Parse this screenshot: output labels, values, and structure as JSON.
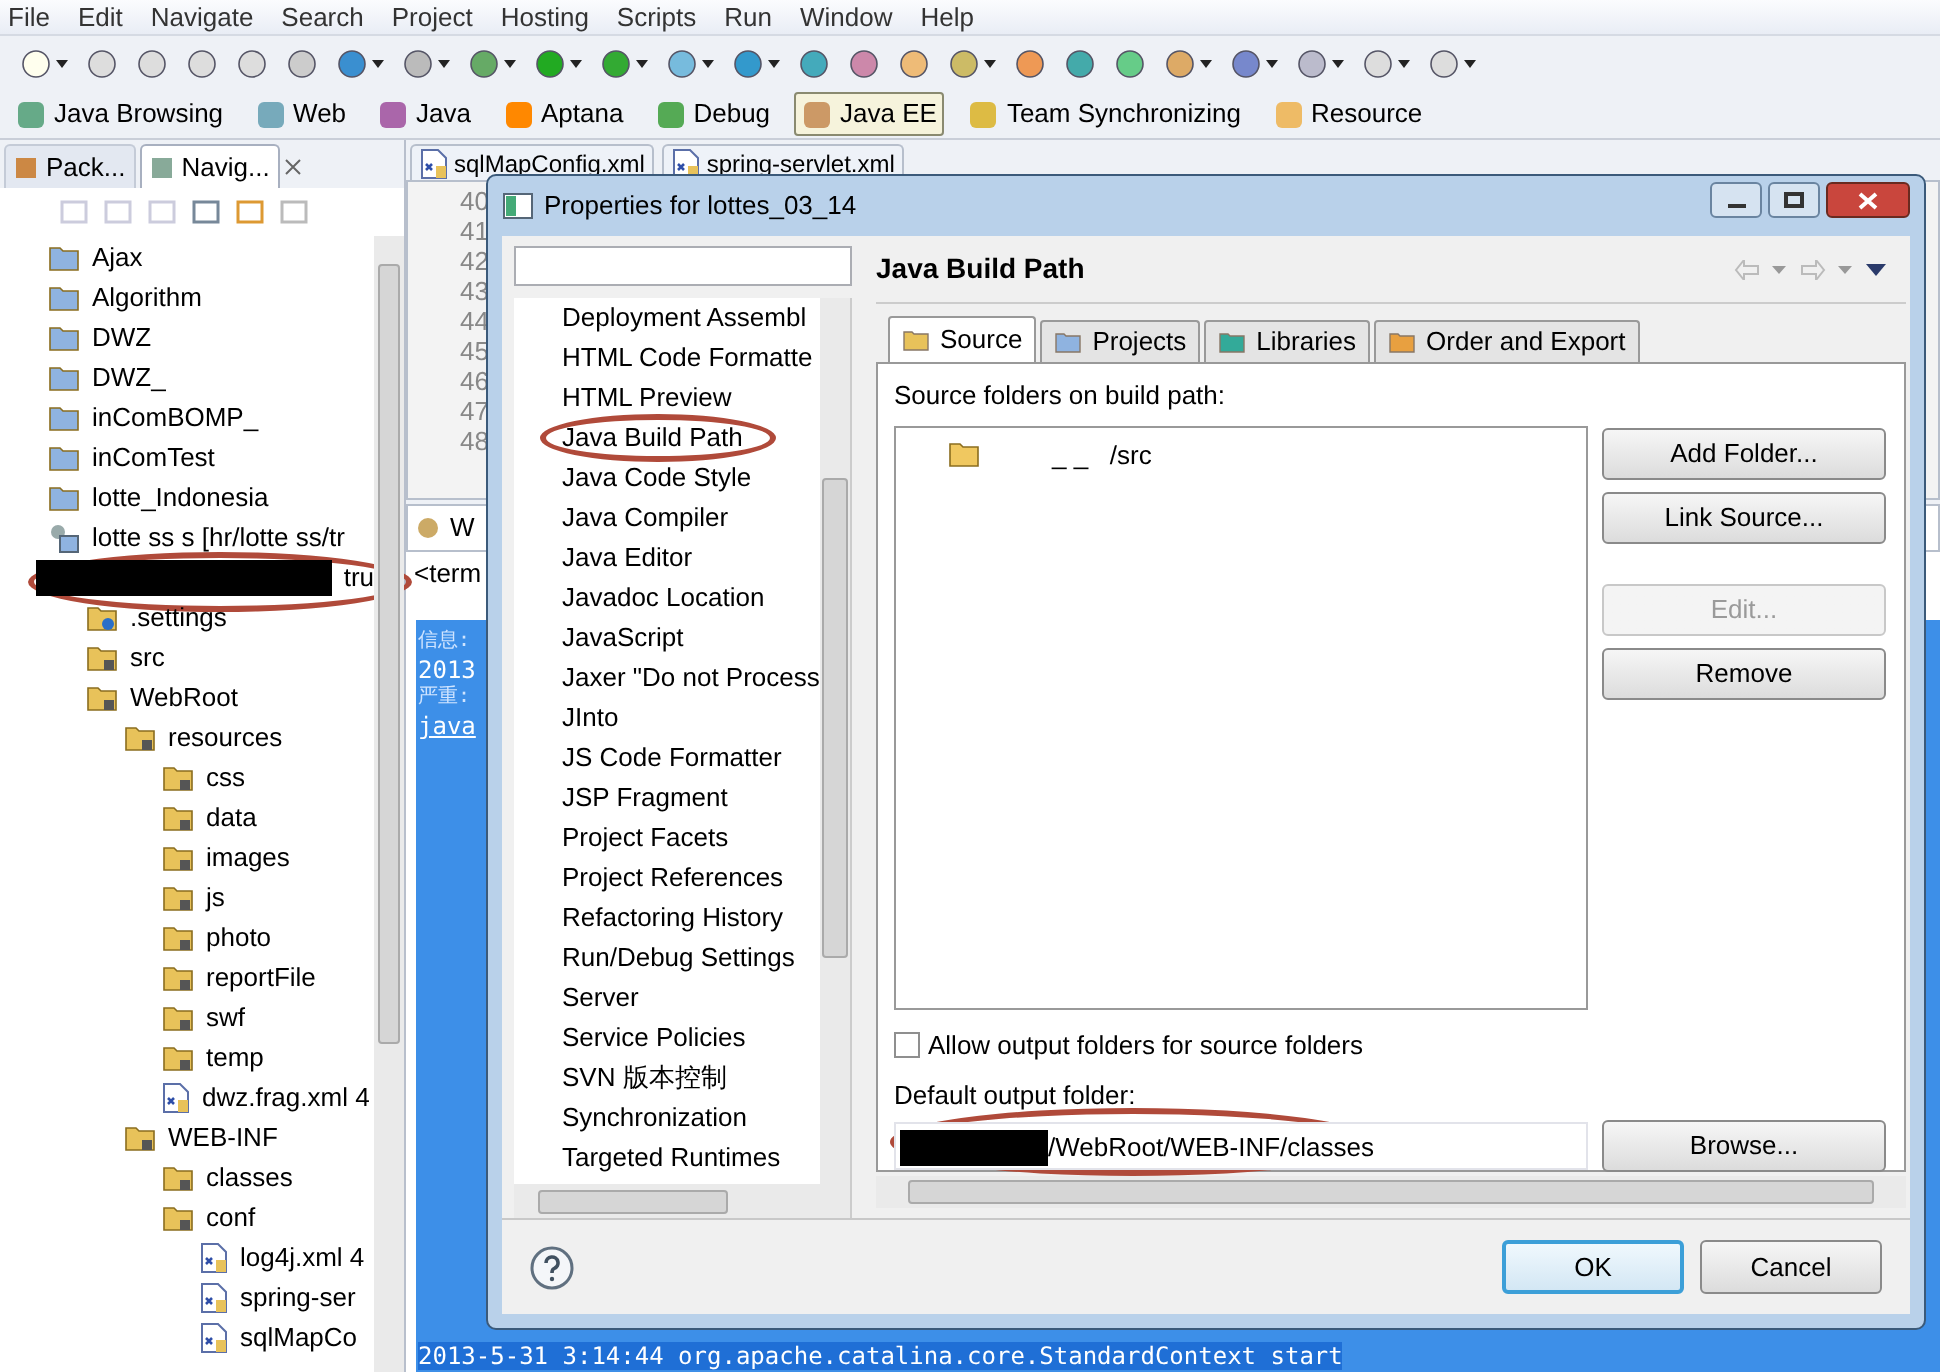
{
  "menu_bar": [
    "File",
    "Edit",
    "Navigate",
    "Search",
    "Project",
    "Hosting",
    "Scripts",
    "Run",
    "Window",
    "Help"
  ],
  "perspectives": [
    {
      "label": "Java Browsing",
      "selected": false
    },
    {
      "label": "Web",
      "selected": false
    },
    {
      "label": "Java",
      "selected": false
    },
    {
      "label": "Aptana",
      "selected": false
    },
    {
      "label": "Debug",
      "selected": false
    },
    {
      "label": "Java EE",
      "selected": true
    },
    {
      "label": "Team Synchronizing",
      "selected": false
    },
    {
      "label": "Resource",
      "selected": false
    }
  ],
  "navigator": {
    "tabs": [
      {
        "label": "Pack...",
        "selected": false
      },
      {
        "label": "Navig...",
        "selected": true
      }
    ],
    "tree": [
      {
        "kind": "project",
        "label": "Ajax"
      },
      {
        "kind": "project",
        "label": "Algorithm"
      },
      {
        "kind": "project",
        "label": "DWZ"
      },
      {
        "kind": "project",
        "label": "DWZ_"
      },
      {
        "kind": "project",
        "label": "inComBOMP_"
      },
      {
        "kind": "project",
        "label": "inComTest"
      },
      {
        "kind": "project",
        "label": "lotte_Indonesia"
      },
      {
        "kind": "repo",
        "label": "lotte ss s [hr/lotte ss/tr"
      },
      {
        "kind": "redacted",
        "label": "tru",
        "children": [
          {
            "kind": "settings",
            "label": ".settings"
          },
          {
            "kind": "folder",
            "label": "src"
          },
          {
            "kind": "folder",
            "label": "WebRoot",
            "children": [
              {
                "kind": "folder",
                "label": "resources",
                "children": [
                  {
                    "kind": "folder",
                    "label": "css"
                  },
                  {
                    "kind": "folder",
                    "label": "data"
                  },
                  {
                    "kind": "folder",
                    "label": "images"
                  },
                  {
                    "kind": "folder",
                    "label": "js"
                  },
                  {
                    "kind": "folder",
                    "label": "photo"
                  },
                  {
                    "kind": "folder",
                    "label": "reportFile"
                  },
                  {
                    "kind": "folder",
                    "label": "swf"
                  },
                  {
                    "kind": "folder",
                    "label": "temp"
                  },
                  {
                    "kind": "xml",
                    "label": "dwz.frag.xml 4"
                  }
                ]
              },
              {
                "kind": "folder",
                "label": "WEB-INF",
                "children": [
                  {
                    "kind": "folder",
                    "label": "classes"
                  },
                  {
                    "kind": "folder",
                    "label": "conf",
                    "children": [
                      {
                        "kind": "xml",
                        "label": "log4j.xml 4"
                      },
                      {
                        "kind": "xml",
                        "label": "spring-ser"
                      },
                      {
                        "kind": "xml",
                        "label": "sqlMapCo"
                      }
                    ]
                  }
                ]
              }
            ]
          }
        ]
      }
    ]
  },
  "editor": {
    "tabs": [
      "sqlMapConfig.xml",
      "spring-servlet.xml"
    ],
    "line_numbers": [
      "40",
      "41",
      "42",
      "43",
      "44",
      "45",
      "46",
      "47",
      "48"
    ]
  },
  "console": {
    "tab": "W",
    "header": "<term",
    "lines": [
      {
        "kind": "label",
        "text": "信息:"
      },
      {
        "kind": "plain",
        "text": "2013"
      },
      {
        "kind": "label",
        "text": "严重:"
      },
      {
        "kind": "link",
        "text": "java"
      }
    ],
    "bottom_line": "2013-5-31 3:14:44 org.apache.catalina.core.StandardContext start"
  },
  "dialog": {
    "title": "Properties for lottes_03_14",
    "pages": [
      "Deployment Assembl",
      "HTML Code Formatte",
      "HTML Preview",
      "Java Build Path",
      "Java Code Style",
      "Java Compiler",
      "Java Editor",
      "Javadoc Location",
      "JavaScript",
      "Jaxer \"Do not Process",
      "JInto",
      "JS Code Formatter",
      "JSP Fragment",
      "Project Facets",
      "Project References",
      "Refactoring History",
      "Run/Debug Settings",
      "Server",
      "Service Policies",
      "SVN 版本控制",
      "Synchronization",
      "Targeted Runtimes"
    ],
    "page_title": "Java Build Path",
    "tabs": [
      {
        "label": "Source",
        "selected": true
      },
      {
        "label": "Projects",
        "selected": false
      },
      {
        "label": "Libraries",
        "selected": false
      },
      {
        "label": "Order and Export",
        "selected": false
      }
    ],
    "source_label": "Source folders on build path:",
    "source_entries": [
      {
        "prefix": "_ _",
        "path": "/src"
      }
    ],
    "side_buttons": [
      [
        {
          "label": "Add Folder...",
          "disabled": false
        },
        {
          "label": "Link Source...",
          "disabled": false
        }
      ],
      [
        {
          "label": "Edit...",
          "disabled": true
        },
        {
          "label": "Remove",
          "disabled": false
        }
      ]
    ],
    "allow_output": {
      "label": "Allow output folders for source folders",
      "checked": false
    },
    "output_label": "Default output folder:",
    "output_value": "/WebRoot/WEB-INF/classes",
    "browse": "Browse...",
    "ok": "OK",
    "cancel": "Cancel"
  }
}
